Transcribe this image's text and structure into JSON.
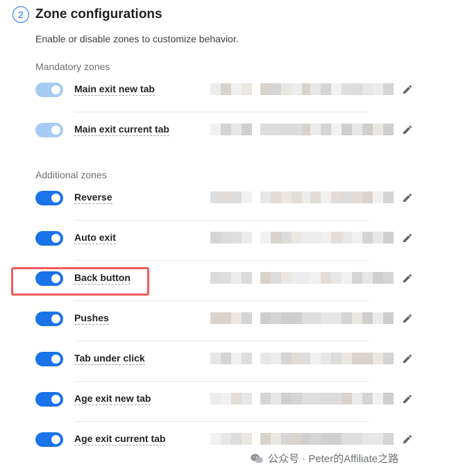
{
  "section": {
    "step_number": "2",
    "title": "Zone configurations",
    "description": "Enable or disable zones to customize behavior."
  },
  "groups": [
    {
      "label": "Mandatory zones",
      "zones": [
        {
          "name": "Main exit new tab",
          "enabled": true,
          "locked": true
        },
        {
          "name": "Main exit current tab",
          "enabled": true,
          "locked": true
        }
      ]
    },
    {
      "label": "Additional zones",
      "zones": [
        {
          "name": "Reverse",
          "enabled": true,
          "locked": false
        },
        {
          "name": "Auto exit",
          "enabled": true,
          "locked": false
        },
        {
          "name": "Back button",
          "enabled": true,
          "locked": false,
          "highlighted": true
        },
        {
          "name": "Pushes",
          "enabled": true,
          "locked": false
        },
        {
          "name": "Tab under click",
          "enabled": true,
          "locked": false
        },
        {
          "name": "Age exit new tab",
          "enabled": true,
          "locked": false
        },
        {
          "name": "Age exit current tab",
          "enabled": true,
          "locked": false
        }
      ]
    }
  ],
  "icons": {
    "edit": "pencil-icon",
    "watermark_logo": "wechat-logo-icon"
  },
  "colors": {
    "accent": "#1a73e8",
    "toggle_locked": "#a8cbf5",
    "highlight_box": "#f25a5a"
  },
  "watermark": {
    "text": "公众号 · Peter的Affiliate之路"
  }
}
